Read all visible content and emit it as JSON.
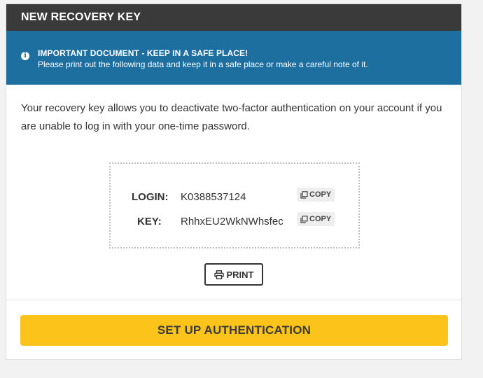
{
  "header": {
    "title": "NEW RECOVERY KEY"
  },
  "alert": {
    "icon": "info-icon",
    "title": "IMPORTANT DOCUMENT - KEEP IN A SAFE PLACE!",
    "text": "Please print out the following data and keep it in a safe place or make a careful note of it."
  },
  "intro": {
    "text": "Your recovery key allows you to deactivate two-factor authentication on your account if you are unable to log in with your one-time password."
  },
  "credentials": {
    "login_label": "LOGIN:",
    "login_value": "K0388537124",
    "key_label": "KEY:",
    "key_value": "RhhxEU2WkNWhsfec",
    "copy_label": "COPY",
    "copy_icon": "copy-icon"
  },
  "actions": {
    "print_label": "PRINT",
    "print_icon": "printer-icon",
    "setup_label": "SET UP AUTHENTICATION"
  },
  "colors": {
    "header_bg": "#3a3a3a",
    "alert_bg": "#1d6fa0",
    "primary_button": "#fcc31a"
  }
}
